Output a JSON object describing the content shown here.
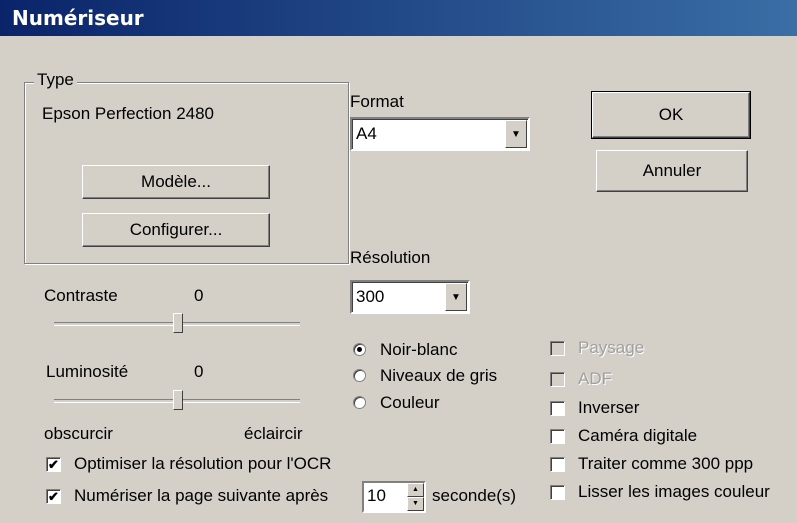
{
  "window": {
    "title": "Numériseur"
  },
  "type_group": {
    "label": "Type",
    "device": "Epson Perfection 2480",
    "model_button": "Modèle...",
    "configure_button": "Configurer..."
  },
  "contrast": {
    "label": "Contraste",
    "value": "0",
    "level": 0.5
  },
  "brightness": {
    "label": "Luminosité",
    "value": "0",
    "level": 0.5,
    "min_label": "obscurcir",
    "max_label": "éclaircir"
  },
  "format": {
    "label": "Format",
    "selected": "A4"
  },
  "resolution": {
    "label": "Résolution",
    "selected": "300"
  },
  "color_modes": [
    {
      "label": "Noir-blanc",
      "checked": true
    },
    {
      "label": "Niveaux de gris",
      "checked": false
    },
    {
      "label": "Couleur",
      "checked": false
    }
  ],
  "options": [
    {
      "label": "Paysage",
      "checked": false,
      "enabled": false
    },
    {
      "label": "ADF",
      "checked": false,
      "enabled": false
    },
    {
      "label": "Inverser",
      "checked": false,
      "enabled": true
    },
    {
      "label": "Caméra digitale",
      "checked": false,
      "enabled": true
    },
    {
      "label": "Traiter comme 300 ppp",
      "checked": false,
      "enabled": true
    },
    {
      "label": "Lisser les images couleur",
      "checked": false,
      "enabled": true
    }
  ],
  "ocr_optimize": {
    "label": "Optimiser la résolution pour l'OCR",
    "checked": true
  },
  "next_page": {
    "label": "Numériser la page suivante après",
    "checked": true,
    "seconds": "10",
    "unit": "seconde(s)"
  },
  "buttons": {
    "ok": "OK",
    "cancel": "Annuler"
  }
}
